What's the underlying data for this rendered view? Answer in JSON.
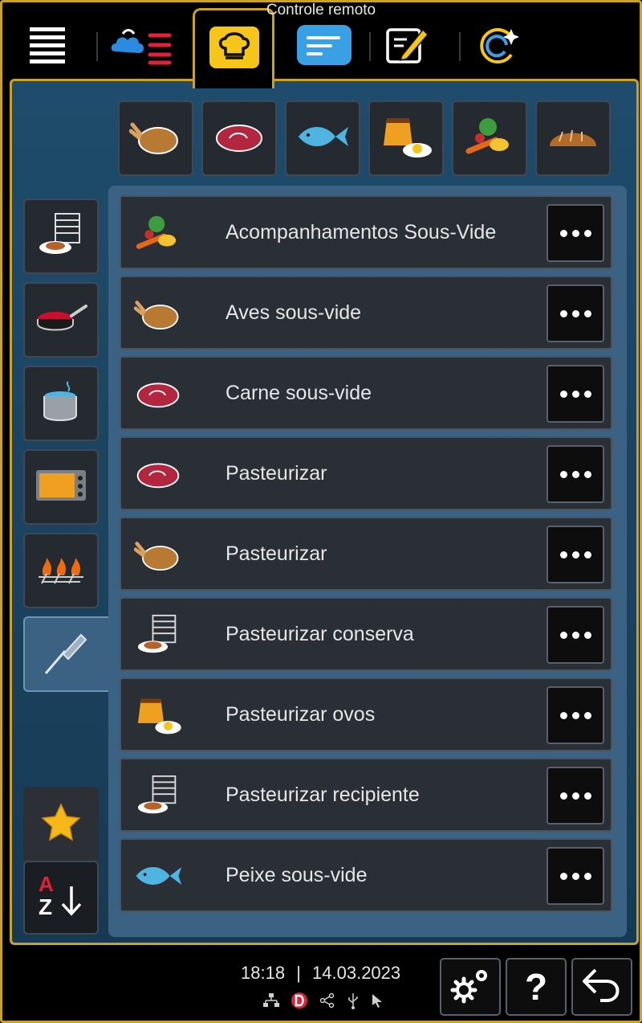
{
  "window": {
    "remote_label": "Controle remoto"
  },
  "top_nav": {
    "tabs": [
      {
        "icon": "menu-lines-icon"
      },
      {
        "icon": "steam-heat-icon"
      },
      {
        "icon": "chef-hat-icon",
        "active": true
      },
      {
        "icon": "program-list-icon"
      },
      {
        "icon": "edit-program-icon"
      },
      {
        "icon": "intelligent-cooking-icon"
      }
    ]
  },
  "categories": [
    {
      "icon": "poultry-icon"
    },
    {
      "icon": "meat-icon"
    },
    {
      "icon": "fish-icon"
    },
    {
      "icon": "egg-dessert-icon"
    },
    {
      "icon": "vegetables-icon"
    },
    {
      "icon": "bread-icon"
    }
  ],
  "side_modes": [
    {
      "icon": "rack-plate-icon"
    },
    {
      "icon": "frying-pan-icon"
    },
    {
      "icon": "boiling-pot-icon"
    },
    {
      "icon": "oven-icon"
    },
    {
      "icon": "grill-icon"
    },
    {
      "icon": "core-probe-icon",
      "active": true
    }
  ],
  "programs": [
    {
      "label": "Acompanhamentos Sous-Vide",
      "icon": "vegetables-icon"
    },
    {
      "label": "Aves sous-vide",
      "icon": "poultry-icon"
    },
    {
      "label": "Carne sous-vide",
      "icon": "meat-icon"
    },
    {
      "label": "Pasteurizar",
      "icon": "meat-icon"
    },
    {
      "label": "Pasteurizar",
      "icon": "poultry-icon"
    },
    {
      "label": "Pasteurizar conserva",
      "icon": "rack-plate-icon"
    },
    {
      "label": "Pasteurizar ovos",
      "icon": "egg-dessert-icon"
    },
    {
      "label": "Pasteurizar recipiente",
      "icon": "rack-plate-icon"
    },
    {
      "label": "Peixe sous-vide",
      "icon": "fish-icon"
    }
  ],
  "footer": {
    "time": "18:18",
    "date": "14.03.2023",
    "separator": "|"
  },
  "sort": {
    "letter_top": "A",
    "letter_bottom": "Z"
  },
  "colors": {
    "accent_gold": "#c9a227",
    "panel_blue": "#3b6283",
    "tab_yellow": "#f5c518",
    "icon_blue": "#3aa0e6"
  }
}
